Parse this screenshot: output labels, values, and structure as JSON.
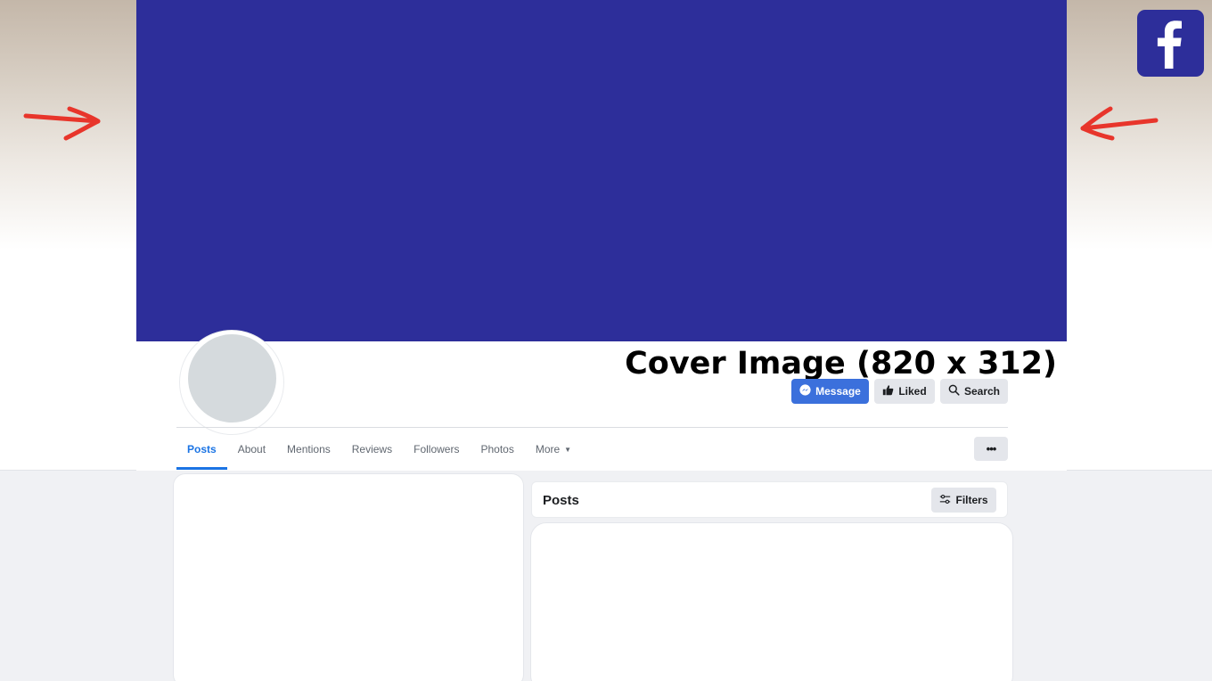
{
  "colors": {
    "cover": "#2d2e9a",
    "brand_blue": "#1b74e4",
    "message_button": "#3b70dc",
    "facebook_logo": "#2d2e9a",
    "avatar_placeholder": "#d5dadd",
    "annotation_arrow": "#e8352b"
  },
  "cover_label": "Cover Image (820 x 312)",
  "actions": {
    "message": "Message",
    "liked": "Liked",
    "search": "Search"
  },
  "tabs": [
    {
      "label": "Posts",
      "active": true
    },
    {
      "label": "About",
      "active": false
    },
    {
      "label": "Mentions",
      "active": false
    },
    {
      "label": "Reviews",
      "active": false
    },
    {
      "label": "Followers",
      "active": false
    },
    {
      "label": "Photos",
      "active": false
    },
    {
      "label": "More",
      "active": false
    }
  ],
  "more_button": "•••",
  "posts_section": {
    "title": "Posts",
    "filters": "Filters"
  },
  "icons": {
    "messenger": "messenger-icon",
    "liked": "thumbs-up-icon",
    "search": "search-icon",
    "more_caret": "caret-down-icon",
    "filters": "sliders-icon",
    "logo": "facebook-logo-icon",
    "arrows": "arrow-icon"
  }
}
